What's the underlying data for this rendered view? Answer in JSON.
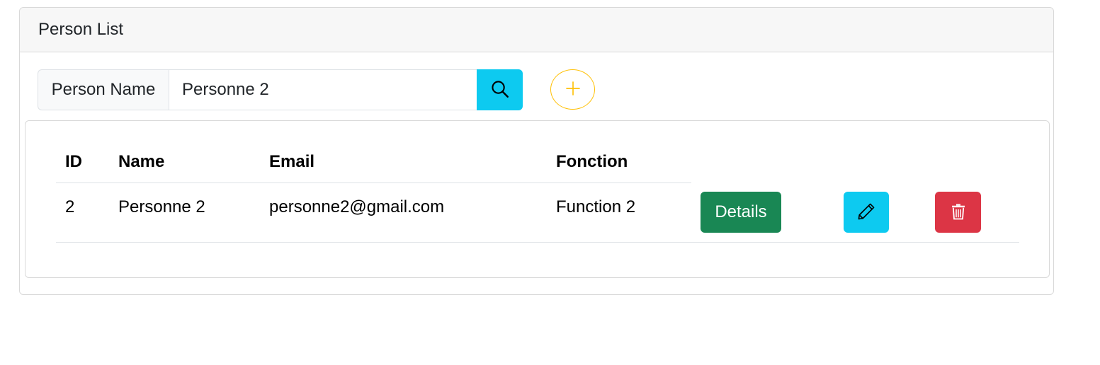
{
  "card": {
    "title": "Person List"
  },
  "search": {
    "label": "Person Name",
    "value": "Personne 2",
    "button_icon": "search-icon"
  },
  "add_button": {
    "icon": "plus-icon",
    "color": "#ffc107"
  },
  "table": {
    "columns": [
      "ID",
      "Name",
      "Email",
      "Fonction"
    ],
    "rows": [
      {
        "id": "2",
        "name": "Personne 2",
        "email": "personne2@gmail.com",
        "fonction": "Function 2",
        "actions": {
          "details_label": "Details",
          "edit_icon": "pencil-icon",
          "delete_icon": "trash-icon"
        }
      }
    ]
  },
  "colors": {
    "info": "#0dcaf0",
    "success": "#198754",
    "danger": "#dc3545",
    "warning": "#ffc107"
  }
}
